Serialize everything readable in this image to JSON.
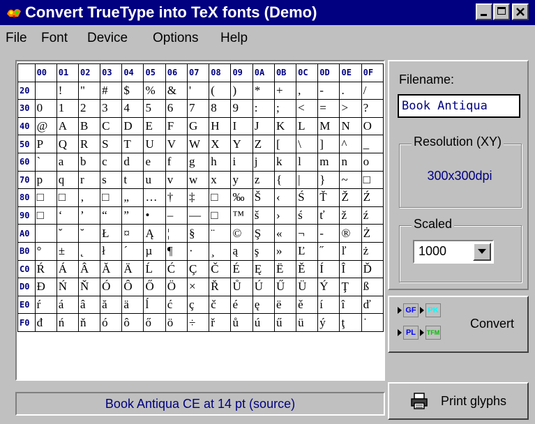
{
  "window": {
    "title": "Convert TrueType into TeX fonts (Demo)"
  },
  "menu": [
    "File",
    "Font",
    "Device",
    "Options",
    "Help"
  ],
  "grid": {
    "col_headers": [
      "00",
      "01",
      "02",
      "03",
      "04",
      "05",
      "06",
      "07",
      "08",
      "09",
      "0A",
      "0B",
      "0C",
      "0D",
      "0E",
      "0F"
    ],
    "rows": [
      {
        "h": "20",
        "c": [
          "",
          "!",
          "\"",
          "#",
          "$",
          "%",
          "&",
          "'",
          "(",
          ")",
          "*",
          "+",
          ",",
          "-",
          ".",
          "/"
        ]
      },
      {
        "h": "30",
        "c": [
          "0",
          "1",
          "2",
          "3",
          "4",
          "5",
          "6",
          "7",
          "8",
          "9",
          ":",
          ";",
          "<",
          "=",
          ">",
          "?"
        ]
      },
      {
        "h": "40",
        "c": [
          "@",
          "A",
          "B",
          "C",
          "D",
          "E",
          "F",
          "G",
          "H",
          "I",
          "J",
          "K",
          "L",
          "M",
          "N",
          "O"
        ]
      },
      {
        "h": "50",
        "c": [
          "P",
          "Q",
          "R",
          "S",
          "T",
          "U",
          "V",
          "W",
          "X",
          "Y",
          "Z",
          "[",
          "\\",
          "]",
          "^",
          "_"
        ]
      },
      {
        "h": "60",
        "c": [
          "`",
          "a",
          "b",
          "c",
          "d",
          "e",
          "f",
          "g",
          "h",
          "i",
          "j",
          "k",
          "l",
          "m",
          "n",
          "o"
        ]
      },
      {
        "h": "70",
        "c": [
          "p",
          "q",
          "r",
          "s",
          "t",
          "u",
          "v",
          "w",
          "x",
          "y",
          "z",
          "{",
          "|",
          "}",
          "~",
          "□"
        ]
      },
      {
        "h": "80",
        "c": [
          "□",
          "□",
          "‚",
          "□",
          "„",
          "…",
          "†",
          "‡",
          "□",
          "‰",
          "Š",
          "‹",
          "Ś",
          "Ť",
          "Ž",
          "Ź"
        ]
      },
      {
        "h": "90",
        "c": [
          "□",
          "‘",
          "’",
          "“",
          "”",
          "•",
          "–",
          "—",
          "□",
          "™",
          "š",
          "›",
          "ś",
          "ť",
          "ž",
          "ź"
        ]
      },
      {
        "h": "A0",
        "c": [
          "",
          "ˇ",
          "˘",
          "Ł",
          "¤",
          "Ą",
          "¦",
          "§",
          "¨",
          "©",
          "Ş",
          "«",
          "¬",
          "-",
          "®",
          "Ż"
        ]
      },
      {
        "h": "B0",
        "c": [
          "°",
          "±",
          "˛",
          "ł",
          "´",
          "µ",
          "¶",
          "·",
          "¸",
          "ą",
          "ş",
          "»",
          "Ľ",
          "˝",
          "ľ",
          "ż"
        ]
      },
      {
        "h": "C0",
        "c": [
          "Ŕ",
          "Á",
          "Â",
          "Ă",
          "Ä",
          "Ĺ",
          "Ć",
          "Ç",
          "Č",
          "É",
          "Ę",
          "Ë",
          "Ě",
          "Í",
          "Î",
          "Ď"
        ]
      },
      {
        "h": "D0",
        "c": [
          "Đ",
          "Ń",
          "Ň",
          "Ó",
          "Ô",
          "Ő",
          "Ö",
          "×",
          "Ř",
          "Ů",
          "Ú",
          "Ű",
          "Ü",
          "Ý",
          "Ţ",
          "ß"
        ]
      },
      {
        "h": "E0",
        "c": [
          "ŕ",
          "á",
          "â",
          "ă",
          "ä",
          "ĺ",
          "ć",
          "ç",
          "č",
          "é",
          "ę",
          "ë",
          "ě",
          "í",
          "î",
          "ď"
        ]
      },
      {
        "h": "F0",
        "c": [
          "đ",
          "ń",
          "ň",
          "ó",
          "ô",
          "ő",
          "ö",
          "÷",
          "ř",
          "ů",
          "ú",
          "ű",
          "ü",
          "ý",
          "ţ",
          "˙"
        ]
      }
    ]
  },
  "status": "Book Antiqua CE at 14 pt (source)",
  "filename": {
    "label": "Filename:",
    "value": "Book Antiqua"
  },
  "resolution": {
    "label": "Resolution (XY)",
    "value": "300x300dpi"
  },
  "scaled": {
    "label": "Scaled",
    "value": "1000"
  },
  "convert": {
    "label": "Convert",
    "badges": [
      "GF",
      "PK",
      "PL",
      "TFM"
    ]
  },
  "print": {
    "label": "Print glyphs"
  },
  "colors": {
    "title_bg": "#000080",
    "face": "#c0c0c0",
    "accent_text": "#000080"
  }
}
